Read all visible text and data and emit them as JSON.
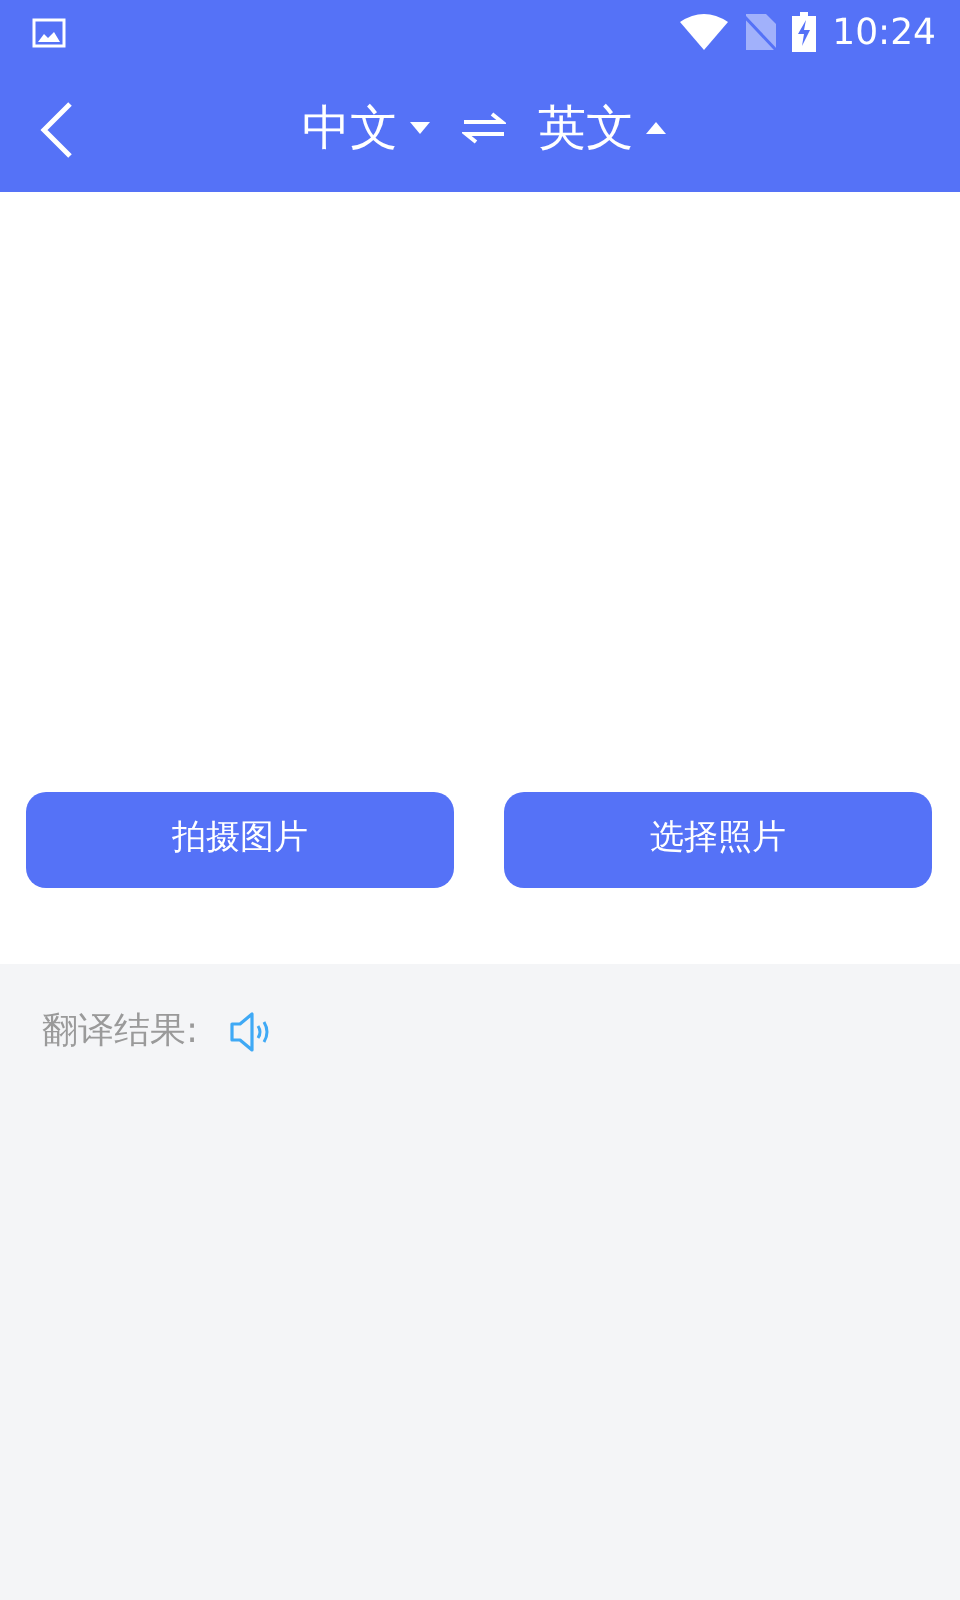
{
  "status_bar": {
    "time": "10:24"
  },
  "header": {
    "source_language": {
      "label": "中文",
      "expanded": false
    },
    "target_language": {
      "label": "英文",
      "expanded": true
    }
  },
  "buttons": [
    {
      "label": "拍摄图片"
    },
    {
      "label": "选择照片"
    }
  ],
  "result": {
    "label": "翻译结果:"
  }
}
